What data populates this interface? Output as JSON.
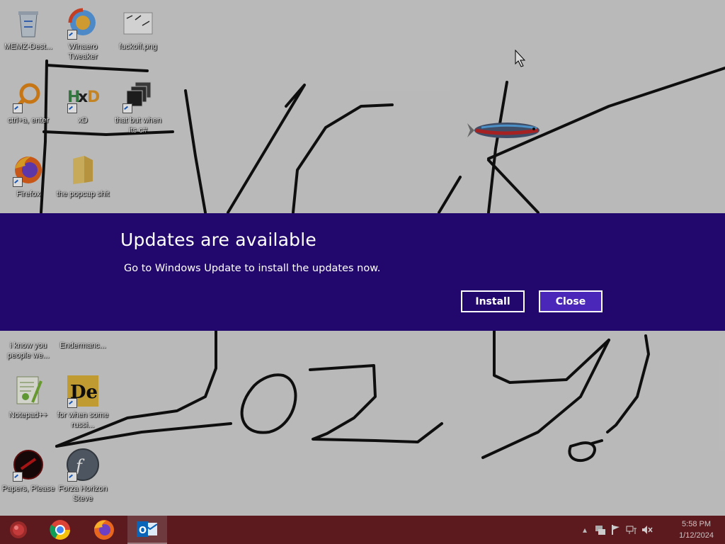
{
  "desktop_icons": [
    {
      "label": "MEMZ-Dest...",
      "icon": "recycle-bin-icon"
    },
    {
      "label": "Winaero Tweaker",
      "icon": "winaero-icon"
    },
    {
      "label": "fuckoff.png",
      "icon": "image-file-icon"
    },
    {
      "label": "ctrl+a, enter",
      "icon": "magnifier-icon"
    },
    {
      "label": "xD",
      "icon": "hxd-icon"
    },
    {
      "label": "that but when its c#",
      "icon": "stacked-windows-icon"
    },
    {
      "label": "Firefox",
      "icon": "firefox-icon"
    },
    {
      "label": "the popcap shit",
      "icon": "folder-icon"
    },
    {
      "label": "i know you people we...",
      "icon": "unknown-icon"
    },
    {
      "label": "Endermanc...",
      "icon": "unknown-icon"
    },
    {
      "label": "Notepad++",
      "icon": "notepad-plus-plus-icon"
    },
    {
      "label": "for when some russi...",
      "icon": "de-icon"
    },
    {
      "label": "Papers, Please",
      "icon": "papers-please-icon"
    },
    {
      "label": "Forza Horizon Steve",
      "icon": "flash-icon"
    }
  ],
  "notification": {
    "title": "Updates are available",
    "message": "Go to Windows Update to install the updates now.",
    "install_label": "Install",
    "close_label": "Close",
    "background": "#22086d",
    "close_background": "#4a27b8"
  },
  "taskbar": {
    "background": "#5c1a1e",
    "apps": [
      "start-orb-icon",
      "chrome-icon",
      "firefox-icon",
      "outlook-icon"
    ],
    "tray_icons": [
      "show-hidden-icons-chevron",
      "network-adapter-icon",
      "action-center-flag-icon",
      "network-icon",
      "volume-muted-icon"
    ],
    "time": "5:58 PM",
    "date": "1/12/2024"
  }
}
